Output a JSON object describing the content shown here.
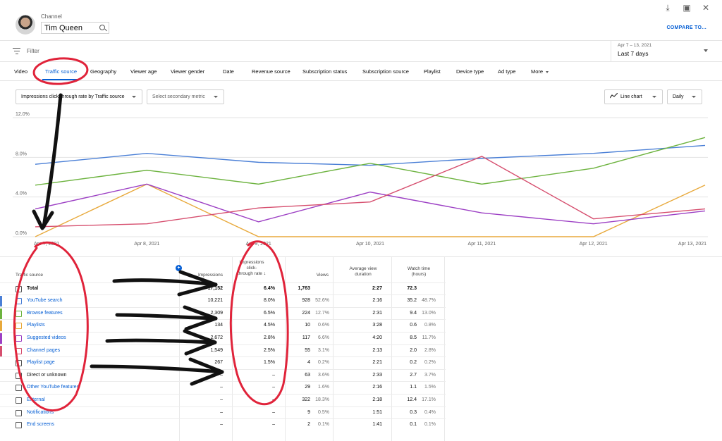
{
  "header": {
    "channel_caption": "Channel",
    "channel_name": "Tim Queen",
    "compare_label": "COMPARE TO...",
    "icons": [
      "download-icon",
      "feedback-icon",
      "close-icon"
    ]
  },
  "filter": {
    "label": "Filter",
    "date_range": "Apr 7 – 13, 2021",
    "date_label": "Last 7 days"
  },
  "tabs": [
    {
      "label": "Video"
    },
    {
      "label": "Traffic source",
      "active": true
    },
    {
      "label": "Geography"
    },
    {
      "label": "Viewer age"
    },
    {
      "label": "Viewer gender"
    },
    {
      "label": "Date"
    },
    {
      "label": "Revenue source"
    },
    {
      "label": "Subscription status"
    },
    {
      "label": "Subscription source"
    },
    {
      "label": "Playlist"
    },
    {
      "label": "Device type"
    },
    {
      "label": "Ad type"
    },
    {
      "label": "More"
    }
  ],
  "controls": {
    "metric": "Impressions click-through rate by Traffic source",
    "secondary_metric": "Select secondary metric",
    "chart_type": "Line chart",
    "granularity": "Daily"
  },
  "chart_data": {
    "type": "line",
    "x": [
      "Apr 7, 2021",
      "Apr 8, 2021",
      "Apr 9, 2021",
      "Apr 10, 2021",
      "Apr 11, 2021",
      "Apr 12, 2021",
      "Apr 13, 2021"
    ],
    "y_ticks": [
      "0.0%",
      "4.0%",
      "8.0%",
      "12.0%"
    ],
    "ylim": [
      0,
      12
    ],
    "grid": true,
    "series": [
      {
        "name": "YouTube search",
        "color": "#4a7fd6",
        "values": [
          7.3,
          8.4,
          7.5,
          7.2,
          7.9,
          8.4,
          9.2
        ]
      },
      {
        "name": "Browse features",
        "color": "#6db33f",
        "values": [
          5.2,
          6.7,
          5.3,
          7.4,
          5.3,
          6.9,
          10.0
        ]
      },
      {
        "name": "Playlists",
        "color": "#e8a93b",
        "values": [
          0.0,
          5.3,
          0.0,
          0.0,
          0.0,
          0.0,
          5.2
        ]
      },
      {
        "name": "Suggested videos",
        "color": "#9c3fc4",
        "values": [
          2.8,
          5.3,
          1.5,
          4.5,
          2.4,
          1.3,
          2.6
        ]
      },
      {
        "name": "Channel pages",
        "color": "#d64e6e",
        "values": [
          1.0,
          1.3,
          2.9,
          3.5,
          8.1,
          1.8,
          2.8
        ]
      }
    ]
  },
  "table": {
    "headers": {
      "source": "Traffic source",
      "impressions": "Impressions",
      "ctr": [
        "Impressions",
        "click-",
        "through rate"
      ],
      "views": "Views",
      "avd": [
        "Average view",
        "duration"
      ],
      "watch": [
        "Watch time",
        "(hours)"
      ]
    },
    "sort_arrow": "↓",
    "rows": [
      {
        "name": "Total",
        "impressions": "17,152",
        "ctr": "6.4%",
        "views": "1,763",
        "views_pct": "",
        "avd": "2:27",
        "watch": "72.3",
        "watch_pct": "",
        "color": "#555555",
        "link": false,
        "total": true
      },
      {
        "name": "YouTube search",
        "impressions": "10,221",
        "ctr": "8.0%",
        "views": "928",
        "views_pct": "52.6%",
        "avd": "2:16",
        "watch": "35.2",
        "watch_pct": "48.7%",
        "color": "#4a7fd6",
        "link": true
      },
      {
        "name": "Browse features",
        "impressions": "2,309",
        "ctr": "6.5%",
        "views": "224",
        "views_pct": "12.7%",
        "avd": "2:31",
        "watch": "9.4",
        "watch_pct": "13.0%",
        "color": "#6db33f",
        "link": true
      },
      {
        "name": "Playlists",
        "impressions": "134",
        "ctr": "4.5%",
        "views": "10",
        "views_pct": "0.6%",
        "avd": "3:28",
        "watch": "0.6",
        "watch_pct": "0.8%",
        "color": "#e8a93b",
        "link": true
      },
      {
        "name": "Suggested videos",
        "impressions": "2,672",
        "ctr": "2.8%",
        "views": "117",
        "views_pct": "6.6%",
        "avd": "4:20",
        "watch": "8.5",
        "watch_pct": "11.7%",
        "color": "#9c3fc4",
        "link": true
      },
      {
        "name": "Channel pages",
        "impressions": "1,549",
        "ctr": "2.5%",
        "views": "55",
        "views_pct": "3.1%",
        "avd": "2:13",
        "watch": "2.0",
        "watch_pct": "2.8%",
        "color": "#d64e6e",
        "link": true
      },
      {
        "name": "Playlist page",
        "impressions": "267",
        "ctr": "1.5%",
        "views": "4",
        "views_pct": "0.2%",
        "avd": "2:21",
        "watch": "0.2",
        "watch_pct": "0.2%",
        "color": "#555555",
        "link": true
      },
      {
        "name": "Direct or unknown",
        "impressions": "–",
        "ctr": "–",
        "views": "63",
        "views_pct": "3.6%",
        "avd": "2:33",
        "watch": "2.7",
        "watch_pct": "3.7%",
        "color": "#555555",
        "link": false
      },
      {
        "name": "Other YouTube features",
        "impressions": "–",
        "ctr": "–",
        "views": "29",
        "views_pct": "1.6%",
        "avd": "2:16",
        "watch": "1.1",
        "watch_pct": "1.5%",
        "color": "#555555",
        "link": true
      },
      {
        "name": "External",
        "impressions": "–",
        "ctr": "–",
        "views": "322",
        "views_pct": "18.3%",
        "avd": "2:18",
        "watch": "12.4",
        "watch_pct": "17.1%",
        "color": "#555555",
        "link": true
      },
      {
        "name": "Notifications",
        "impressions": "–",
        "ctr": "–",
        "views": "9",
        "views_pct": "0.5%",
        "avd": "1:51",
        "watch": "0.3",
        "watch_pct": "0.4%",
        "color": "#555555",
        "link": true
      },
      {
        "name": "End screens",
        "impressions": "–",
        "ctr": "–",
        "views": "2",
        "views_pct": "0.1%",
        "avd": "1:41",
        "watch": "0.1",
        "watch_pct": "0.1%",
        "color": "#555555",
        "link": true
      }
    ]
  },
  "colors": {
    "accent": "#065fd4",
    "annotation_red": "#e0233a",
    "annotation_black": "#111111"
  }
}
